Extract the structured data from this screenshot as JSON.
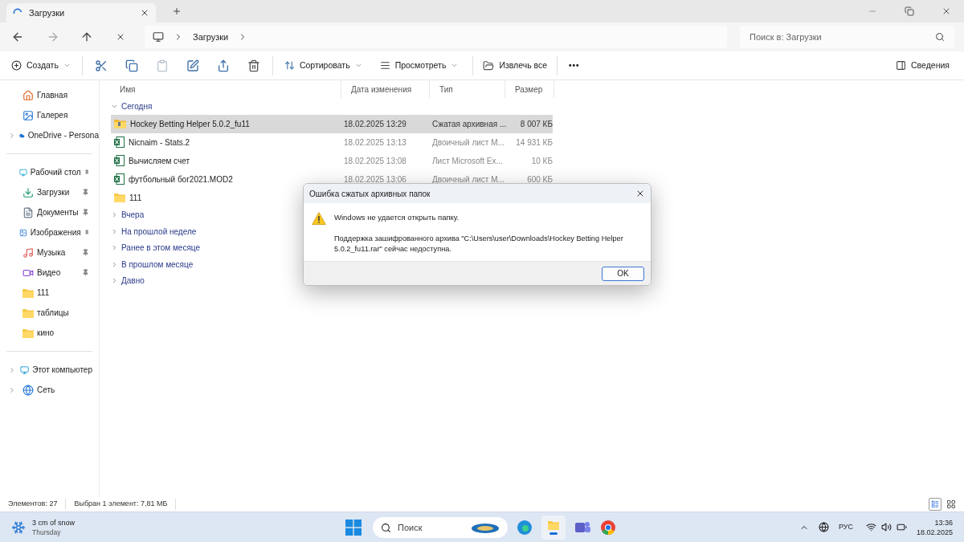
{
  "tab": {
    "title": "Загрузки"
  },
  "address": {
    "crumbs": [
      "Загрузки"
    ],
    "search_placeholder": "Поиск в: Загрузки"
  },
  "toolbar": {
    "new_label": "Создать",
    "actions": [
      {
        "kind": "cut",
        "disabled": false
      },
      {
        "kind": "copy",
        "disabled": false
      },
      {
        "kind": "paste",
        "disabled": true
      },
      {
        "kind": "rename",
        "disabled": false
      },
      {
        "kind": "share",
        "disabled": false
      },
      {
        "kind": "delete",
        "disabled": false
      }
    ],
    "sort_label": "Сортировать",
    "view_label": "Просмотреть",
    "extract_label": "Извлечь все",
    "more_label": "•••",
    "details_label": "Сведения"
  },
  "sidebar": {
    "sections": [
      [
        {
          "kind": "home",
          "label": "Главная",
          "expandable": false,
          "pinned": false
        },
        {
          "kind": "gallery",
          "label": "Галерея",
          "expandable": false,
          "pinned": false
        },
        {
          "kind": "cloud",
          "label": "OneDrive - Persona",
          "expandable": true,
          "pinned": false
        }
      ],
      [
        {
          "kind": "desktop",
          "label": "Рабочий стол",
          "expandable": false,
          "pinned": true
        },
        {
          "kind": "downloads",
          "label": "Загрузки",
          "expandable": false,
          "pinned": true
        },
        {
          "kind": "documents",
          "label": "Документы",
          "expandable": false,
          "pinned": true
        },
        {
          "kind": "pictures",
          "label": "Изображения",
          "expandable": false,
          "pinned": true
        },
        {
          "kind": "music",
          "label": "Музыка",
          "expandable": false,
          "pinned": true
        },
        {
          "kind": "videos",
          "label": "Видео",
          "expandable": false,
          "pinned": true
        },
        {
          "kind": "folder",
          "label": "111",
          "expandable": false,
          "pinned": false
        },
        {
          "kind": "folder",
          "label": "таблицы",
          "expandable": false,
          "pinned": false
        },
        {
          "kind": "folder",
          "label": "кино",
          "expandable": false,
          "pinned": false
        }
      ],
      [
        {
          "kind": "pc",
          "label": "Этот компьютер",
          "expandable": true,
          "pinned": false
        },
        {
          "kind": "network",
          "label": "Сеть",
          "expandable": true,
          "pinned": false
        }
      ]
    ]
  },
  "columns": [
    "Имя",
    "Дата изменения",
    "Тип",
    "Размер"
  ],
  "groups": [
    {
      "label": "Сегодня",
      "expanded": true,
      "rows": [
        {
          "kind": "archive",
          "name": "Hockey Betting Helper 5.0.2_fu11",
          "date": "18.02.2025 13:29",
          "type": "Сжатая архивная ...",
          "size": "8 007 КБ",
          "selected": true
        },
        {
          "kind": "sheet",
          "name": "Nicnaim - Stats.2",
          "date": "18.02.2025 13:13",
          "type": "Двоичный лист M...",
          "size": "14 931 КБ",
          "selected": false
        },
        {
          "kind": "sheet",
          "name": "Вычисляем счет",
          "date": "18.02.2025 13:08",
          "type": "Лист Microsoft Ex...",
          "size": "10 КБ",
          "selected": false
        },
        {
          "kind": "sheet",
          "name": "футбольный бог2021.MOD2",
          "date": "18.02.2025 13:06",
          "type": "Двоичный лист M...",
          "size": "600 КБ",
          "selected": false
        },
        {
          "kind": "folder",
          "name": "111",
          "selected": false
        }
      ]
    },
    {
      "label": "Вчера",
      "expanded": false
    },
    {
      "label": "На прошлой неделе",
      "expanded": false
    },
    {
      "label": "Ранее в этом месяце",
      "expanded": false
    },
    {
      "label": "В прошлом месяце",
      "expanded": false
    },
    {
      "label": "Давно",
      "expanded": false
    }
  ],
  "status_bar": {
    "count": "Элементов: 27",
    "selection": "Выбран 1 элемент: 7,81 МБ"
  },
  "dialog": {
    "title": "Ошибка сжатых архивных папок",
    "heading": "Windows не удается открыть папку.",
    "message": "Поддержка зашифрованного архива \"C:\\Users\\user\\Downloads\\Hockey Betting Helper 5.0.2_fu11.rar\" сейчас недоступна.",
    "button": "OK"
  },
  "taskbar": {
    "weather": "3 cm of snow",
    "day": "Thursday",
    "search_placeholder": "Поиск",
    "language": "РУС",
    "time": "13:36",
    "date": "18.02.2025"
  }
}
